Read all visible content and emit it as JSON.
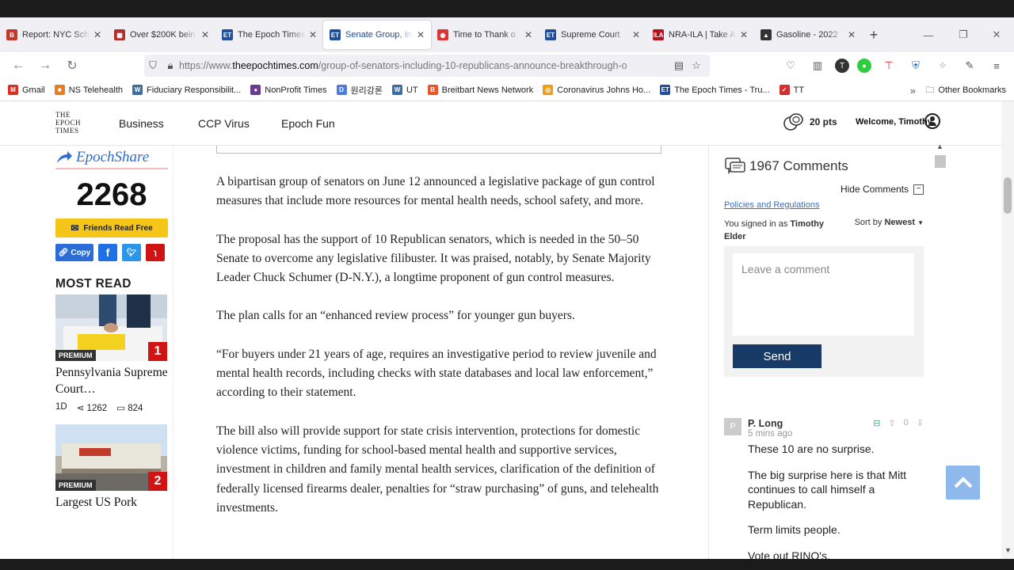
{
  "browser": {
    "tabs": [
      {
        "title": "Report: NYC Sch",
        "favicon": "B",
        "color": "#c0392b"
      },
      {
        "title": "Over $200K bein",
        "favicon": "▦",
        "color": "#b03030"
      },
      {
        "title": "The Epoch Times",
        "favicon": "ET",
        "color": "#1f4e9c"
      },
      {
        "title": "Senate Group, In",
        "favicon": "ET",
        "color": "#1f4e9c",
        "active": true
      },
      {
        "title": "Time to Thank o",
        "favicon": "◉",
        "color": "#d33"
      },
      {
        "title": "Supreme Court",
        "favicon": "ET",
        "color": "#1f4e9c"
      },
      {
        "title": "NRA-ILA | Take A",
        "favicon": "ILA",
        "color": "#b3141b"
      },
      {
        "title": "Gasoline - 2022",
        "favicon": "▲",
        "color": "#333"
      }
    ],
    "url_prefix": "https://www.",
    "url_domain": "theepochtimes.com",
    "url_path": "/group-of-senators-including-10-republicans-announce-breakthrough-o",
    "bookmarks": [
      {
        "label": "Gmail",
        "icon": "M",
        "color": "#d93025"
      },
      {
        "label": "NS Telehealth",
        "icon": "■",
        "color": "#e67e22"
      },
      {
        "label": "Fiduciary Responsibilit...",
        "icon": "W",
        "color": "#3a6ea5"
      },
      {
        "label": "NonProfit Times",
        "icon": "●",
        "color": "#6a3b8c"
      },
      {
        "label": "원리강론",
        "icon": "D",
        "color": "#4a7de0"
      },
      {
        "label": "UT",
        "icon": "W",
        "color": "#3a6ea5"
      },
      {
        "label": "Breitbart News Network",
        "icon": "B",
        "color": "#e8562a"
      },
      {
        "label": "Coronavirus Johns Ho...",
        "icon": "◎",
        "color": "#f39c12"
      },
      {
        "label": "The Epoch Times - Tru...",
        "icon": "ET",
        "color": "#1f4e9c"
      },
      {
        "label": "TT",
        "icon": "✓",
        "color": "#d32f2f"
      }
    ],
    "other_bookmarks": "Other Bookmarks"
  },
  "site": {
    "logo_lines": [
      "THE",
      "EPOCH",
      "TIMES"
    ],
    "nav": [
      "Business",
      "CCP Virus",
      "Epoch Fun"
    ],
    "points": "20 pts",
    "welcome": "Welcome, Timothy"
  },
  "share": {
    "brand": "EpochShare",
    "count": "2268",
    "friends_label": "Friends Read Free",
    "copy_label": "Copy"
  },
  "most_read": {
    "heading": "MOST READ",
    "items": [
      {
        "title": "Pennsylvania Supreme Court…",
        "badge": "PREMIUM",
        "rank": "1",
        "age": "1D",
        "shares": "1262",
        "comments": "824"
      },
      {
        "title": "Largest US Pork Packer Closing…",
        "badge": "PREMIUM",
        "rank": "2"
      }
    ]
  },
  "article": {
    "paragraphs": [
      "A bipartisan group of senators on June 12 announced a legislative package of gun control measures that include more resources for mental health needs, school safety, and more.",
      "The proposal has the support of 10 Republican senators, which is needed in the 50–50 Senate to overcome any legislative filibuster. It was praised, notably, by Senate Majority Leader Chuck Schumer (D-N.Y.), a longtime proponent of gun control measures.",
      "The plan calls for an “enhanced review process” for younger gun buyers.",
      "“For buyers under 21 years of age, requires an investigative period to review juvenile and mental health records, including checks with state databases and local law enforcement,” according to their statement.",
      "The bill also will provide support for state crisis intervention, protections for domestic violence victims, funding for school-based mental health and supportive services, investment in children and family mental health services, clarification of the definition of federally licensed firearms dealer, penalties for “straw purchasing” of guns, and telehealth investments."
    ]
  },
  "comments": {
    "count_label": "1967 Comments",
    "hide_label": "Hide Comments",
    "policies_label": "Policies and Regulations",
    "signed_in_prefix": "You signed in as",
    "signed_in_user": "Timothy Elder",
    "sort_prefix": "Sort by",
    "sort_value": "Newest",
    "placeholder": "Leave a comment",
    "send_label": "Send",
    "items": [
      {
        "avatar": "P",
        "author": "P. Long",
        "time": "5 mins ago",
        "votes": "0",
        "lines": [
          "These 10 are no surprise.",
          "The big surprise here is that Mitt continues to call himself a Republican.",
          "Term limits people.",
          "Vote out RINO's."
        ]
      }
    ]
  }
}
